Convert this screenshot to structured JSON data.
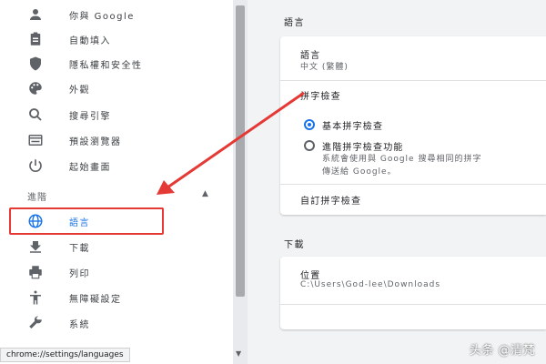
{
  "sidebar": {
    "items": [
      {
        "label": "你與 Google",
        "icon": "person-icon"
      },
      {
        "label": "自動填入",
        "icon": "clipboard-icon"
      },
      {
        "label": "隱私權和安全性",
        "icon": "shield-icon"
      },
      {
        "label": "外觀",
        "icon": "palette-icon"
      },
      {
        "label": "搜尋引擎",
        "icon": "search-icon"
      },
      {
        "label": "預設瀏覽器",
        "icon": "browser-icon"
      },
      {
        "label": "起始畫面",
        "icon": "power-icon"
      }
    ],
    "advanced_heading": "進階",
    "advanced_items": [
      {
        "label": "語言",
        "icon": "globe-icon",
        "active": true
      },
      {
        "label": "下載",
        "icon": "download-icon"
      },
      {
        "label": "列印",
        "icon": "printer-icon"
      },
      {
        "label": "無障礙設定",
        "icon": "accessibility-icon"
      },
      {
        "label": "系統",
        "icon": "wrench-icon"
      }
    ]
  },
  "main": {
    "languages_section_title": "語言",
    "languages_card": {
      "language_label": "語言",
      "language_value": "中文 (繁體)",
      "spellcheck_label": "拼字檢查",
      "basic_option": "基本拼字檢查",
      "enhanced_option": "進階拼字檢查功能",
      "enhanced_desc_line1": "系統會使用與 Google 搜尋相同的拼字",
      "enhanced_desc_line2": "傳送給 Google。",
      "custom_spellcheck": "自訂拼字檢查"
    },
    "downloads_section_title": "下載",
    "downloads_card": {
      "location_label": "位置",
      "location_value": "C:\\Users\\God-lee\\Downloads"
    }
  },
  "status_url": "chrome://settings/languages",
  "watermark": "头条 @清梵",
  "colors": {
    "accent": "#1a73e8",
    "highlight": "#e53935"
  }
}
